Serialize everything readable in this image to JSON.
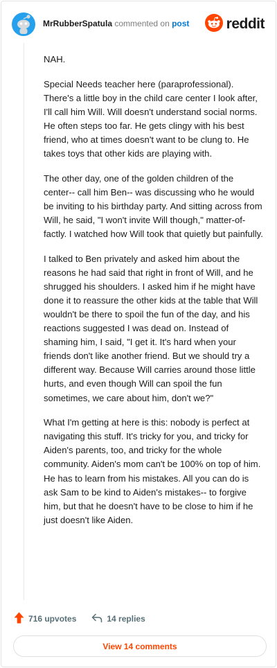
{
  "header": {
    "author": "MrRubberSpatula",
    "verb": "commented on",
    "link_text": "post",
    "logo_text": "reddit"
  },
  "comment": {
    "paragraphs": [
      "NAH.",
      "Special Needs teacher here (paraprofessional). There's a little boy in the child care center I look after, I'll call him Will. Will doesn't understand social norms. He often steps too far. He gets clingy with his best friend, who at times doesn't want to be clung to. He takes toys that other kids are playing with.",
      "The other day, one of the golden children of the center-- call him Ben-- was discussing who he would be inviting to his birthday party. And sitting across from Will, he said, \"I won't invite Will though,\" matter-of-factly. I watched how Will took that quietly but painfully.",
      "I talked to Ben privately and asked him about the reasons he had said that right in front of Will, and he shrugged his shoulders. I asked him if he might have done it to reassure the other kids at the table that Will wouldn't be there to spoil the fun of the day, and his reactions suggested I was dead on. Instead of shaming him, I said, \"I get it. It's hard when your friends don't like another friend. But we should try a different way. Because Will carries around those little hurts, and even though Will can spoil the fun sometimes, we care about him, don't we?\"",
      "What I'm getting at here is this: nobody is perfect at navigating this stuff. It's tricky for you, and tricky for Aiden's parents, too, and tricky for the whole community. Aiden's mom can't be 100% on top of him. He has to learn from his mistakes. All you can do is ask Sam to be kind to Aiden's mistakes-- to forgive him, but that he doesn't have to be close to him if he just doesn't like Aiden."
    ]
  },
  "actions": {
    "upvotes": "716 upvotes",
    "replies": "14 replies"
  },
  "view_button": "View 14 comments",
  "colors": {
    "accent": "#ff4500",
    "link": "#0079d3",
    "avatar": "#24a0ed"
  },
  "icons": [
    "avatar-icon",
    "reddit-logo-icon",
    "upvote-icon",
    "reply-icon"
  ]
}
